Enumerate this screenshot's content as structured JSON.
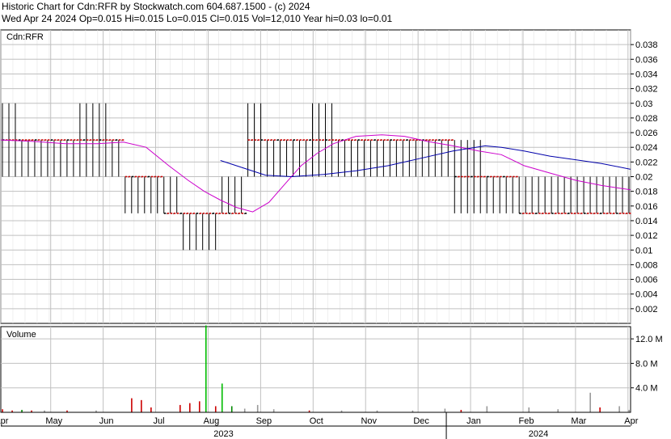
{
  "header": {
    "line1": "Historic Chart for Cdn:RFR by Stockwatch.com 604.687.1500 - (c) 2024",
    "line2": "Wed Apr 24 2024   Op=0.015   Hi=0.015   Lo=0.015   Cl=0.015   Vol=12,010   Year hi=0.03   lo=0.01"
  },
  "chart_data": [
    {
      "type": "line",
      "title": "Cdn:RFR",
      "ylim": [
        0,
        0.04
      ],
      "yticks": [
        "0.038",
        "0.036",
        "0.034",
        "0.032",
        "0.03",
        "0.028",
        "0.026",
        "0.024",
        "0.022",
        "0.02",
        "0.018",
        "0.016",
        "0.014",
        "0.012",
        "0.01",
        "0.008",
        "0.006",
        "0.004",
        "0.002"
      ],
      "grid": true,
      "months": [
        "Apr",
        "May",
        "Jun",
        "Jul",
        "Aug",
        "Sep",
        "Oct",
        "Nov",
        "Dec",
        "Jan",
        "Feb",
        "Mar",
        "Apr"
      ],
      "years": [
        "2023",
        "2024"
      ],
      "price_levels": [
        {
          "from": 0,
          "to": 5,
          "close": 0.025,
          "hi": 0.03,
          "lo": 0.02
        },
        {
          "from": 5,
          "to": 24,
          "close": 0.025,
          "hi": 0.025,
          "lo": 0.02
        },
        {
          "from": 24,
          "to": 34,
          "close": 0.025,
          "hi": 0.03,
          "lo": 0.02
        },
        {
          "from": 34,
          "to": 38,
          "close": 0.025,
          "hi": 0.025,
          "lo": 0.02
        },
        {
          "from": 38,
          "to": 50,
          "close": 0.02,
          "hi": 0.02,
          "lo": 0.015
        },
        {
          "from": 50,
          "to": 56,
          "close": 0.015,
          "hi": 0.02,
          "lo": 0.015
        },
        {
          "from": 56,
          "to": 68,
          "close": 0.015,
          "hi": 0.015,
          "lo": 0.01
        },
        {
          "from": 68,
          "to": 76,
          "close": 0.015,
          "hi": 0.02,
          "lo": 0.015
        },
        {
          "from": 76,
          "to": 82,
          "close": 0.025,
          "hi": 0.03,
          "lo": 0.02
        },
        {
          "from": 82,
          "to": 96,
          "close": 0.025,
          "hi": 0.025,
          "lo": 0.02
        },
        {
          "from": 96,
          "to": 104,
          "close": 0.025,
          "hi": 0.03,
          "lo": 0.02
        },
        {
          "from": 104,
          "to": 140,
          "close": 0.025,
          "hi": 0.025,
          "lo": 0.02
        },
        {
          "from": 140,
          "to": 150,
          "close": 0.02,
          "hi": 0.025,
          "lo": 0.015
        },
        {
          "from": 150,
          "to": 160,
          "close": 0.02,
          "hi": 0.02,
          "lo": 0.015
        },
        {
          "from": 160,
          "to": 195,
          "close": 0.015,
          "hi": 0.02,
          "lo": 0.015
        }
      ],
      "series": [
        {
          "name": "",
          "color": "#cc00cc",
          "x": [
            0,
            10,
            20,
            30,
            38,
            45,
            52,
            58,
            63,
            68,
            73,
            78,
            83,
            88,
            93,
            98,
            103,
            110,
            118,
            125,
            132,
            140,
            148,
            155,
            162,
            170,
            178,
            186,
            195
          ],
          "y": [
            0.025,
            0.0248,
            0.0245,
            0.0245,
            0.0247,
            0.024,
            0.0215,
            0.0195,
            0.018,
            0.0168,
            0.0158,
            0.0152,
            0.0165,
            0.019,
            0.0215,
            0.0232,
            0.0245,
            0.0255,
            0.0257,
            0.0255,
            0.0248,
            0.0242,
            0.0235,
            0.023,
            0.0215,
            0.0205,
            0.0195,
            0.0188,
            0.0182
          ]
        },
        {
          "name": "",
          "color": "#0000aa",
          "x": [
            68,
            75,
            82,
            90,
            100,
            110,
            120,
            130,
            140,
            150,
            155,
            162,
            170,
            178,
            186,
            195
          ],
          "y": [
            0.0222,
            0.0212,
            0.0202,
            0.02,
            0.0203,
            0.0208,
            0.0215,
            0.0225,
            0.0235,
            0.0242,
            0.024,
            0.0235,
            0.0228,
            0.0223,
            0.0218,
            0.021
          ]
        }
      ]
    },
    {
      "type": "bar",
      "title": "Volume",
      "ylim": [
        0,
        14
      ],
      "yticks": [
        "12.0 M",
        "8.0 M",
        "4.0 M"
      ],
      "bars": [
        {
          "x": 0,
          "v": 0.5,
          "c": "#cc0000"
        },
        {
          "x": 3,
          "v": 0.3,
          "c": "#cc0000"
        },
        {
          "x": 6,
          "v": 0.4,
          "c": "#008800"
        },
        {
          "x": 9,
          "v": 0.3,
          "c": "#cc0000"
        },
        {
          "x": 13,
          "v": 0.3,
          "c": "#999999"
        },
        {
          "x": 20,
          "v": 0.3,
          "c": "#cc0000"
        },
        {
          "x": 29,
          "v": 0.3,
          "c": "#999999"
        },
        {
          "x": 40,
          "v": 2.3,
          "c": "#cc0000"
        },
        {
          "x": 43,
          "v": 2.0,
          "c": "#cc0000"
        },
        {
          "x": 46,
          "v": 0.8,
          "c": "#cc0000"
        },
        {
          "x": 55,
          "v": 1.2,
          "c": "#cc0000"
        },
        {
          "x": 58,
          "v": 1.5,
          "c": "#cc0000"
        },
        {
          "x": 61,
          "v": 1.8,
          "c": "#cc0000"
        },
        {
          "x": 63,
          "v": 14.2,
          "c": "#00bb00"
        },
        {
          "x": 66,
          "v": 1.0,
          "c": "#cc0000"
        },
        {
          "x": 68,
          "v": 4.7,
          "c": "#00bb00"
        },
        {
          "x": 71,
          "v": 1.0,
          "c": "#008800"
        },
        {
          "x": 75,
          "v": 0.6,
          "c": "#999999"
        },
        {
          "x": 79,
          "v": 1.2,
          "c": "#999999"
        },
        {
          "x": 84,
          "v": 0.5,
          "c": "#999999"
        },
        {
          "x": 95,
          "v": 0.3,
          "c": "#cc0000"
        },
        {
          "x": 105,
          "v": 0.3,
          "c": "#999999"
        },
        {
          "x": 116,
          "v": 0.3,
          "c": "#999999"
        },
        {
          "x": 127,
          "v": 0.3,
          "c": "#999999"
        },
        {
          "x": 137,
          "v": 0.6,
          "c": "#999999"
        },
        {
          "x": 142,
          "v": 0.4,
          "c": "#cc0000"
        },
        {
          "x": 150,
          "v": 1.0,
          "c": "#999999"
        },
        {
          "x": 163,
          "v": 0.8,
          "c": "#999999"
        },
        {
          "x": 172,
          "v": 0.5,
          "c": "#999999"
        },
        {
          "x": 182,
          "v": 3.2,
          "c": "#999999"
        },
        {
          "x": 185,
          "v": 0.8,
          "c": "#cc0000"
        },
        {
          "x": 191,
          "v": 1.0,
          "c": "#999999"
        },
        {
          "x": 194,
          "v": 0.4,
          "c": "#999999"
        }
      ]
    }
  ],
  "colors": {
    "up": "#00bb00",
    "down": "#cc0000",
    "bar": "#000000",
    "neutral": "#999999",
    "grid": "#c0c0c0"
  }
}
